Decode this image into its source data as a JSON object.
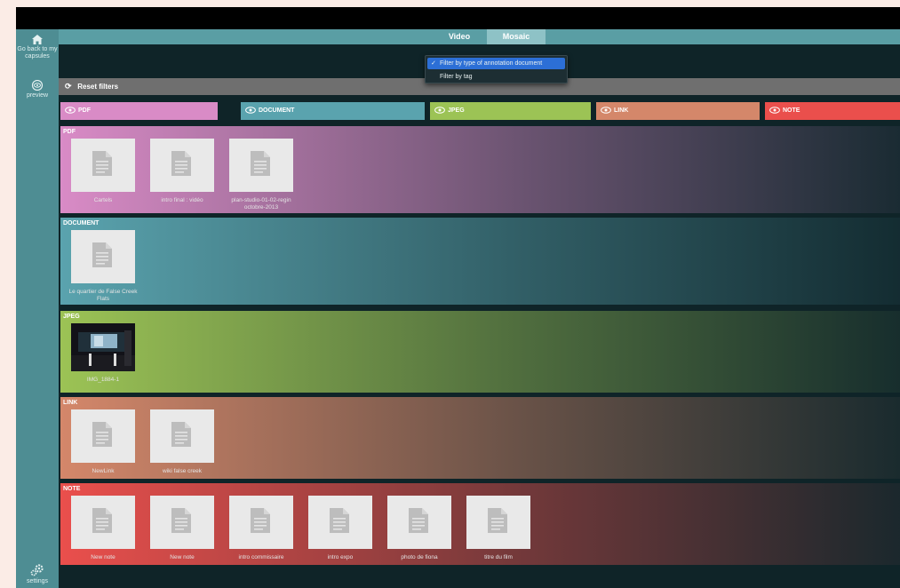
{
  "sidebar": {
    "back_label": "Go back to my capsules",
    "preview_label": "preview",
    "settings_label": "settings"
  },
  "tabs": [
    {
      "label": "Video",
      "active": false
    },
    {
      "label": "Mosaic",
      "active": true
    }
  ],
  "filter_menu": {
    "items": [
      {
        "label": "Filter by type of annotation document",
        "checked": true
      },
      {
        "label": "Filter by tag",
        "checked": false
      }
    ]
  },
  "reset_label": "Reset filters",
  "filters": [
    {
      "label": "PDF",
      "color": "#d98bc6"
    },
    {
      "label": "DOCUMENT",
      "color": "#5aa3ae"
    },
    {
      "label": "JPEG",
      "color": "#9cc355"
    },
    {
      "label": "LINK",
      "color": "#d4876a"
    },
    {
      "label": "NOTE",
      "color": "#ea4f4c"
    }
  ],
  "sections": [
    {
      "title": "PDF",
      "color": "#d98bc6",
      "items": [
        "Cartels",
        "intro final : vidéo",
        "plan-studio-01-02-regin octobre-2013"
      ]
    },
    {
      "title": "DOCUMENT",
      "color": "#5aa3ae",
      "items": [
        "Le quartier de False Creek Flats"
      ]
    },
    {
      "title": "JPEG",
      "color": "#9cc355",
      "items": [
        "IMG_1884-1"
      ]
    },
    {
      "title": "LINK",
      "color": "#d4876a",
      "items": [
        "NewLink",
        "wiki false creek"
      ]
    },
    {
      "title": "NOTE",
      "color": "#ea4f4c",
      "items": [
        "New note",
        "New note",
        "intro commissaire",
        "intro expo",
        "photo de fiona",
        "titre du film"
      ]
    }
  ]
}
